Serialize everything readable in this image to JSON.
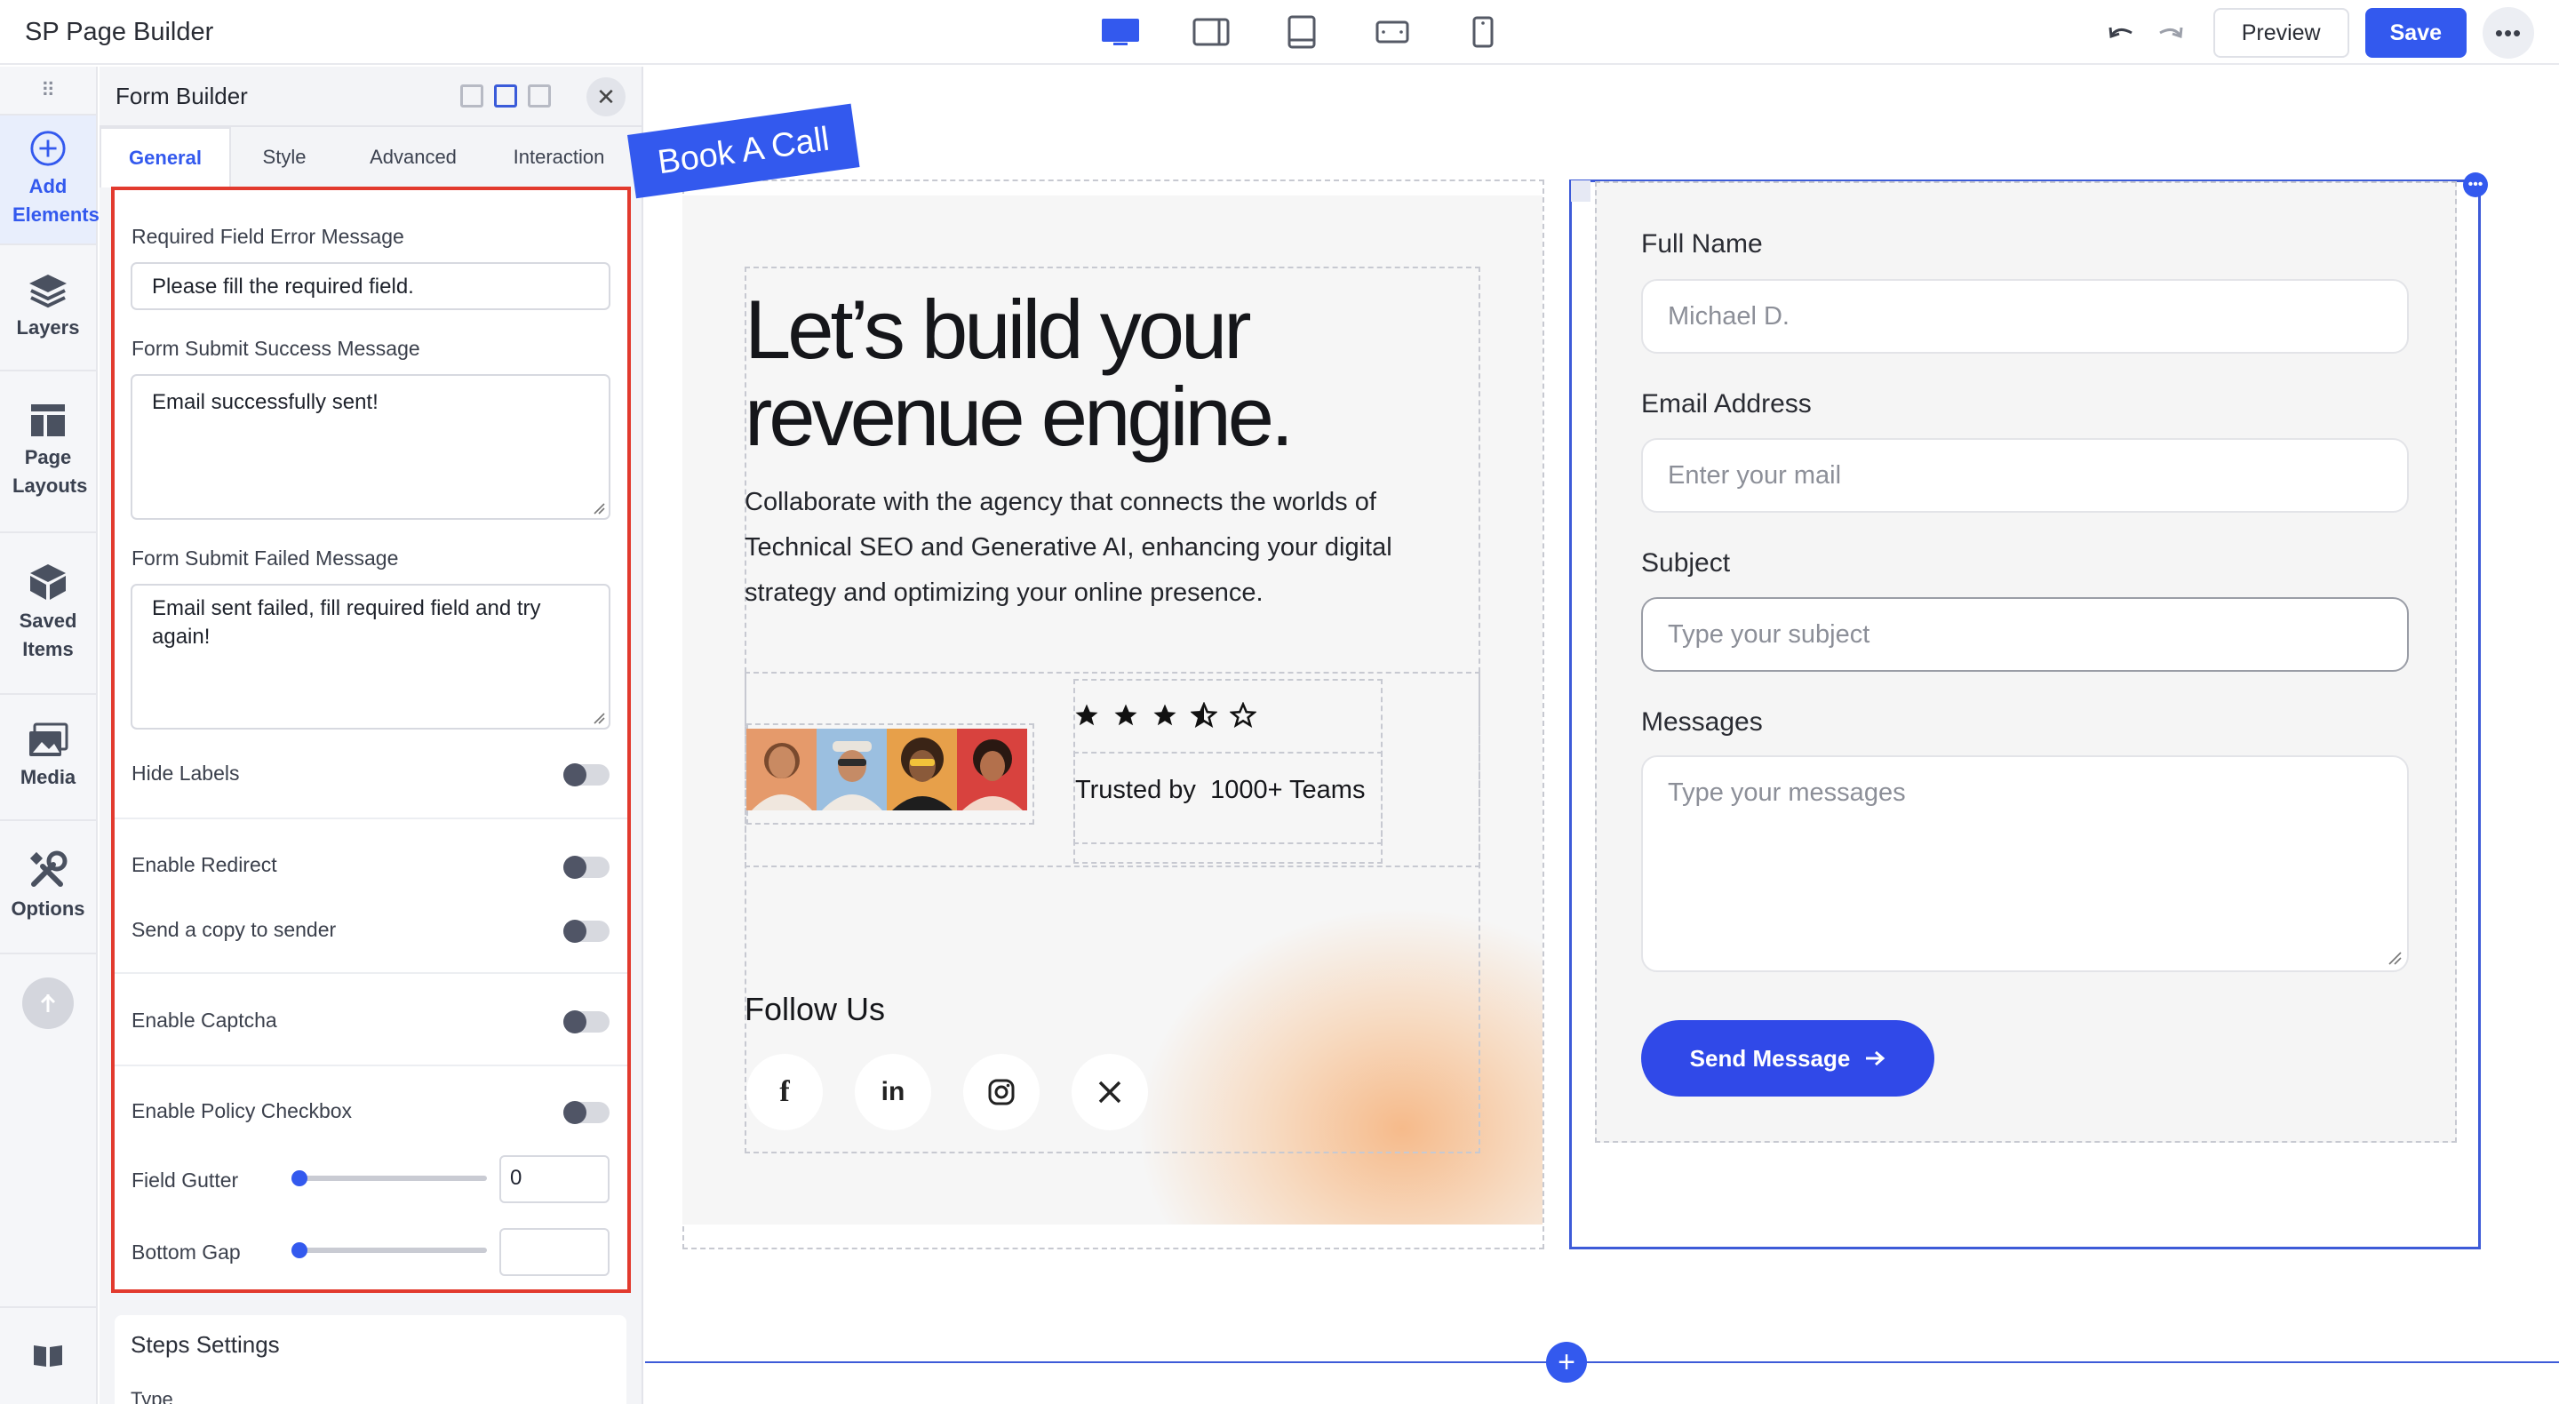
{
  "app": {
    "title": "SP Page Builder"
  },
  "toolbar": {
    "devices": [
      "desktop-icon",
      "tablet-landscape-icon",
      "tablet-icon",
      "mobile-landscape-icon",
      "mobile-icon"
    ],
    "preview_label": "Preview",
    "save_label": "Save",
    "more_label": "•••"
  },
  "rail": {
    "items": [
      {
        "label": "Add Elements",
        "icon": "plus-circle-icon",
        "active": true
      },
      {
        "label": "Layers",
        "icon": "layers-icon",
        "active": false
      },
      {
        "label": "Page Layouts",
        "icon": "layout-icon",
        "active": false
      },
      {
        "label": "Saved Items",
        "icon": "box-icon",
        "active": false
      },
      {
        "label": "Media",
        "icon": "media-icon",
        "active": false
      },
      {
        "label": "Options",
        "icon": "tools-icon",
        "active": false
      }
    ]
  },
  "panel": {
    "title": "Form Builder",
    "tabs": [
      "General",
      "Style",
      "Advanced",
      "Interaction"
    ],
    "active_tab": "General",
    "fields": {
      "required_label": "Required Field Error Message",
      "required_value": "Please fill the required field.",
      "success_label": "Form Submit Success Message",
      "success_value": "Email successfully sent!",
      "failed_label": "Form Submit Failed Message",
      "failed_value": "Email sent failed, fill required field and try again!",
      "hide_labels": "Hide Labels",
      "enable_redirect": "Enable Redirect",
      "send_copy": "Send a copy to sender",
      "enable_captcha": "Enable Captcha",
      "enable_policy": "Enable Policy Checkbox",
      "field_gutter": "Field Gutter",
      "field_gutter_value": "0",
      "bottom_gap": "Bottom Gap",
      "bottom_gap_value": ""
    },
    "steps": {
      "title": "Steps Settings",
      "type_label": "Type"
    }
  },
  "canvas": {
    "ribbon": "Book A Call",
    "headline_line1": "Let’s build your",
    "headline_line2": "revenue engine.",
    "description": "Collaborate with the agency that connects the worlds of Technical SEO and Generative AI, enhancing your digital strategy and optimizing your online presence.",
    "rating": 3.5,
    "trusted_prefix": "Trusted by",
    "trusted_count": "1000+ Teams",
    "follow_title": "Follow Us",
    "socials": [
      "f",
      "in",
      "instagram-icon",
      "x-icon"
    ]
  },
  "form": {
    "full_name_label": "Full Name",
    "full_name_placeholder": "Michael D.",
    "email_label": "Email Address",
    "email_placeholder": "Enter your mail",
    "subject_label": "Subject",
    "subject_placeholder": "Type your subject",
    "messages_label": "Messages",
    "messages_placeholder": "Type your messages",
    "submit_label": "Send Message"
  },
  "colors": {
    "accent": "#3359ee",
    "highlight": "#e23a2e",
    "send_button": "#3049e8"
  }
}
